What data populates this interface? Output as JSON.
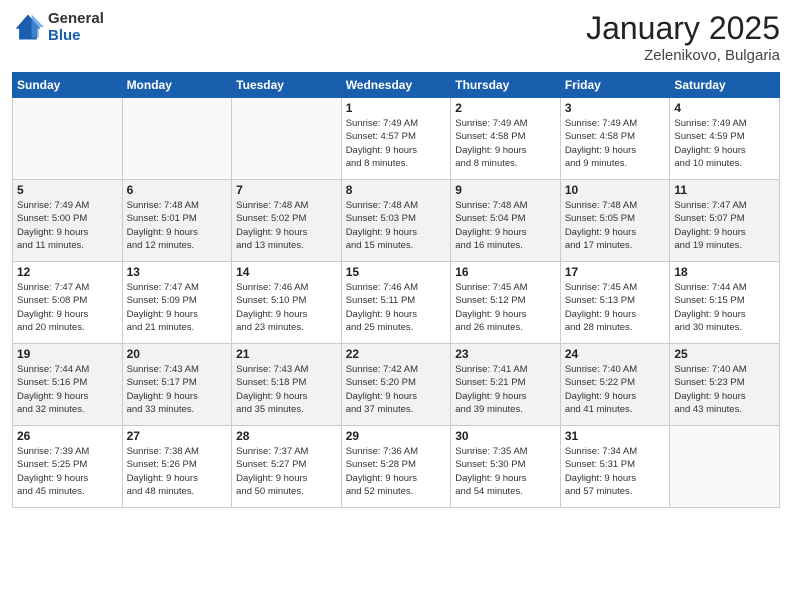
{
  "header": {
    "logo_general": "General",
    "logo_blue": "Blue",
    "month_title": "January 2025",
    "location": "Zelenikovo, Bulgaria"
  },
  "weekdays": [
    "Sunday",
    "Monday",
    "Tuesday",
    "Wednesday",
    "Thursday",
    "Friday",
    "Saturday"
  ],
  "weeks": [
    [
      {
        "day": "",
        "text": ""
      },
      {
        "day": "",
        "text": ""
      },
      {
        "day": "",
        "text": ""
      },
      {
        "day": "1",
        "text": "Sunrise: 7:49 AM\nSunset: 4:57 PM\nDaylight: 9 hours\nand 8 minutes."
      },
      {
        "day": "2",
        "text": "Sunrise: 7:49 AM\nSunset: 4:58 PM\nDaylight: 9 hours\nand 8 minutes."
      },
      {
        "day": "3",
        "text": "Sunrise: 7:49 AM\nSunset: 4:58 PM\nDaylight: 9 hours\nand 9 minutes."
      },
      {
        "day": "4",
        "text": "Sunrise: 7:49 AM\nSunset: 4:59 PM\nDaylight: 9 hours\nand 10 minutes."
      }
    ],
    [
      {
        "day": "5",
        "text": "Sunrise: 7:49 AM\nSunset: 5:00 PM\nDaylight: 9 hours\nand 11 minutes."
      },
      {
        "day": "6",
        "text": "Sunrise: 7:48 AM\nSunset: 5:01 PM\nDaylight: 9 hours\nand 12 minutes."
      },
      {
        "day": "7",
        "text": "Sunrise: 7:48 AM\nSunset: 5:02 PM\nDaylight: 9 hours\nand 13 minutes."
      },
      {
        "day": "8",
        "text": "Sunrise: 7:48 AM\nSunset: 5:03 PM\nDaylight: 9 hours\nand 15 minutes."
      },
      {
        "day": "9",
        "text": "Sunrise: 7:48 AM\nSunset: 5:04 PM\nDaylight: 9 hours\nand 16 minutes."
      },
      {
        "day": "10",
        "text": "Sunrise: 7:48 AM\nSunset: 5:05 PM\nDaylight: 9 hours\nand 17 minutes."
      },
      {
        "day": "11",
        "text": "Sunrise: 7:47 AM\nSunset: 5:07 PM\nDaylight: 9 hours\nand 19 minutes."
      }
    ],
    [
      {
        "day": "12",
        "text": "Sunrise: 7:47 AM\nSunset: 5:08 PM\nDaylight: 9 hours\nand 20 minutes."
      },
      {
        "day": "13",
        "text": "Sunrise: 7:47 AM\nSunset: 5:09 PM\nDaylight: 9 hours\nand 21 minutes."
      },
      {
        "day": "14",
        "text": "Sunrise: 7:46 AM\nSunset: 5:10 PM\nDaylight: 9 hours\nand 23 minutes."
      },
      {
        "day": "15",
        "text": "Sunrise: 7:46 AM\nSunset: 5:11 PM\nDaylight: 9 hours\nand 25 minutes."
      },
      {
        "day": "16",
        "text": "Sunrise: 7:45 AM\nSunset: 5:12 PM\nDaylight: 9 hours\nand 26 minutes."
      },
      {
        "day": "17",
        "text": "Sunrise: 7:45 AM\nSunset: 5:13 PM\nDaylight: 9 hours\nand 28 minutes."
      },
      {
        "day": "18",
        "text": "Sunrise: 7:44 AM\nSunset: 5:15 PM\nDaylight: 9 hours\nand 30 minutes."
      }
    ],
    [
      {
        "day": "19",
        "text": "Sunrise: 7:44 AM\nSunset: 5:16 PM\nDaylight: 9 hours\nand 32 minutes."
      },
      {
        "day": "20",
        "text": "Sunrise: 7:43 AM\nSunset: 5:17 PM\nDaylight: 9 hours\nand 33 minutes."
      },
      {
        "day": "21",
        "text": "Sunrise: 7:43 AM\nSunset: 5:18 PM\nDaylight: 9 hours\nand 35 minutes."
      },
      {
        "day": "22",
        "text": "Sunrise: 7:42 AM\nSunset: 5:20 PM\nDaylight: 9 hours\nand 37 minutes."
      },
      {
        "day": "23",
        "text": "Sunrise: 7:41 AM\nSunset: 5:21 PM\nDaylight: 9 hours\nand 39 minutes."
      },
      {
        "day": "24",
        "text": "Sunrise: 7:40 AM\nSunset: 5:22 PM\nDaylight: 9 hours\nand 41 minutes."
      },
      {
        "day": "25",
        "text": "Sunrise: 7:40 AM\nSunset: 5:23 PM\nDaylight: 9 hours\nand 43 minutes."
      }
    ],
    [
      {
        "day": "26",
        "text": "Sunrise: 7:39 AM\nSunset: 5:25 PM\nDaylight: 9 hours\nand 45 minutes."
      },
      {
        "day": "27",
        "text": "Sunrise: 7:38 AM\nSunset: 5:26 PM\nDaylight: 9 hours\nand 48 minutes."
      },
      {
        "day": "28",
        "text": "Sunrise: 7:37 AM\nSunset: 5:27 PM\nDaylight: 9 hours\nand 50 minutes."
      },
      {
        "day": "29",
        "text": "Sunrise: 7:36 AM\nSunset: 5:28 PM\nDaylight: 9 hours\nand 52 minutes."
      },
      {
        "day": "30",
        "text": "Sunrise: 7:35 AM\nSunset: 5:30 PM\nDaylight: 9 hours\nand 54 minutes."
      },
      {
        "day": "31",
        "text": "Sunrise: 7:34 AM\nSunset: 5:31 PM\nDaylight: 9 hours\nand 57 minutes."
      },
      {
        "day": "",
        "text": ""
      }
    ]
  ]
}
